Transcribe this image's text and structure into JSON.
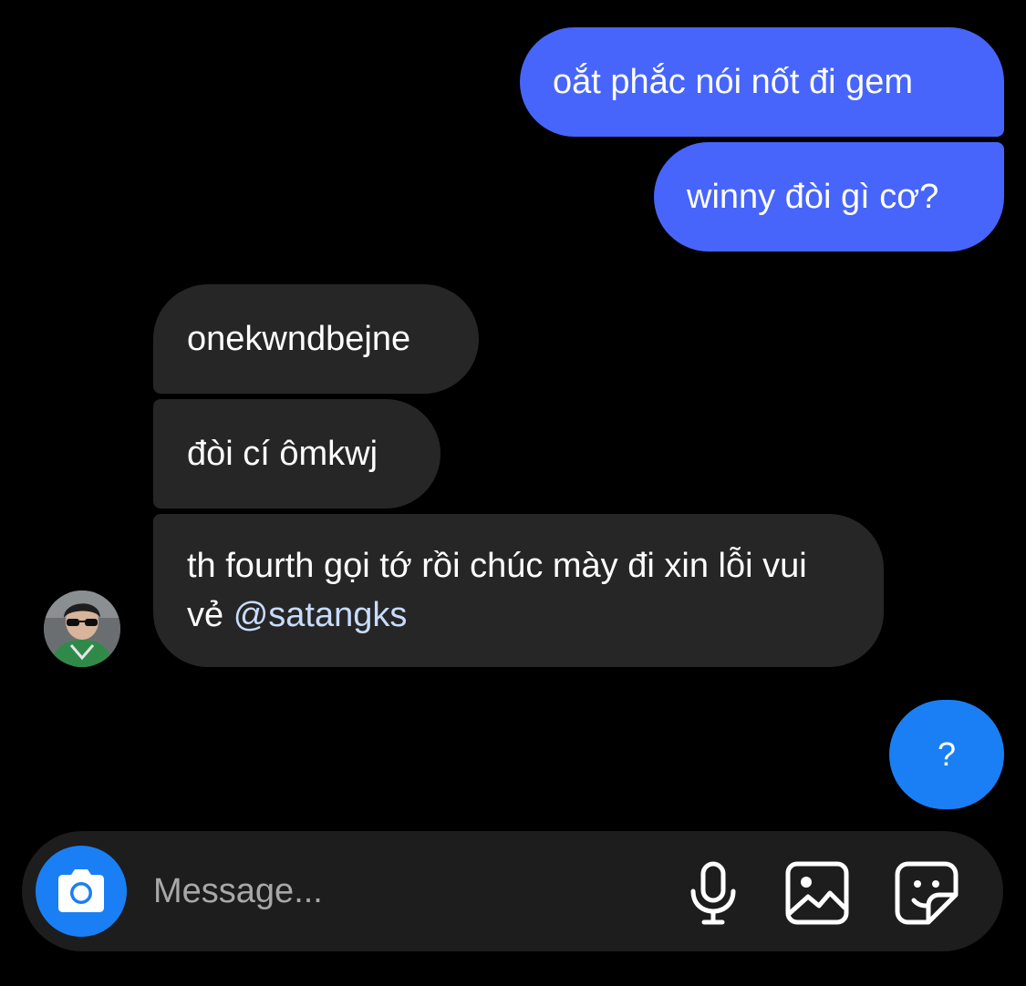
{
  "conversation": {
    "messages": [
      {
        "direction": "outgoing",
        "text": "oắt phắc nói nốt đi gem"
      },
      {
        "direction": "outgoing",
        "text": "winny đòi gì cơ?"
      },
      {
        "direction": "incoming",
        "text": "onekwndbejne"
      },
      {
        "direction": "incoming",
        "text": "đòi cí ômkwj"
      },
      {
        "direction": "incoming",
        "text": "th fourth gọi tớ rồi chúc mày đi xin lỗi vui vẻ ",
        "mention": "@satangks"
      },
      {
        "direction": "outgoing",
        "text": "?"
      }
    ]
  },
  "composer": {
    "placeholder": "Message...",
    "icons": [
      "camera-icon",
      "microphone-icon",
      "gallery-icon",
      "sticker-icon"
    ]
  },
  "colors": {
    "background": "#000000",
    "outgoing_bubble": "#4765fb",
    "outgoing_bubble_last": "#1a7ff4",
    "incoming_bubble": "#262626",
    "mention": "#c8dcff",
    "composer": "#1d1d1d",
    "camera_button": "#1a7ff4"
  }
}
